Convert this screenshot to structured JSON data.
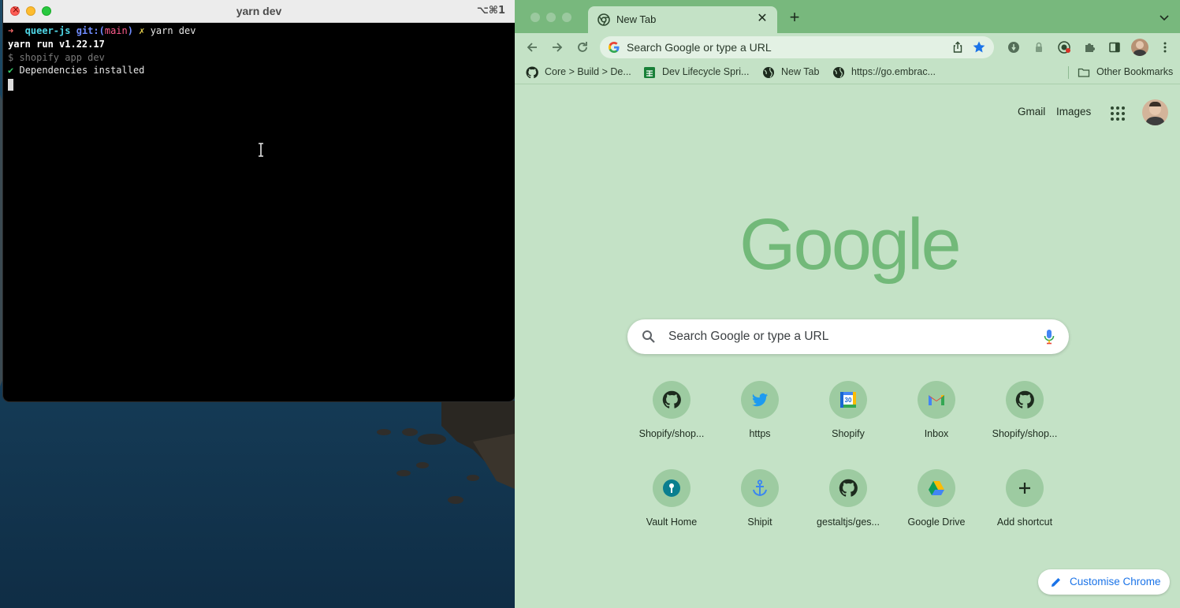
{
  "terminal": {
    "title": "yarn dev",
    "shortcut": "⌥⌘1",
    "prompt_arrow": "➜",
    "prompt_dir": "queer-js",
    "prompt_git": "git:(",
    "prompt_branch": "main",
    "prompt_git_close": ")",
    "prompt_dirty": "✗",
    "prompt_command": "yarn dev",
    "line_yarn_run": "yarn run v1.22.17",
    "line_shopify": "$ shopify app dev",
    "line_check": "✔",
    "line_deps": "Dependencies installed"
  },
  "browser": {
    "tab_title": "New Tab",
    "omnibox_placeholder": "Search Google or type a URL",
    "bookmarks": [
      {
        "label": "Core > Build > De...",
        "icon": "github-icon"
      },
      {
        "label": "Dev Lifecycle Spri...",
        "icon": "sheets-icon"
      },
      {
        "label": "New Tab",
        "icon": "globe-icon"
      },
      {
        "label": "https://go.embrac...",
        "icon": "globe-icon"
      }
    ],
    "other_bookmarks": "Other Bookmarks"
  },
  "ntp": {
    "gmail": "Gmail",
    "images": "Images",
    "logo_text": "Google",
    "search_placeholder": "Search Google or type a URL",
    "shortcuts": [
      {
        "label": "Shopify/shop...",
        "icon": "github-icon"
      },
      {
        "label": "https",
        "icon": "twitter-icon"
      },
      {
        "label": "Shopify",
        "icon": "calendar-icon"
      },
      {
        "label": "Inbox",
        "icon": "gmail-icon"
      },
      {
        "label": "Shopify/shop...",
        "icon": "github-icon"
      },
      {
        "label": "Vault Home",
        "icon": "vault-icon"
      },
      {
        "label": "Shipit",
        "icon": "anchor-icon"
      },
      {
        "label": "gestaltjs/ges...",
        "icon": "github-icon"
      },
      {
        "label": "Google Drive",
        "icon": "drive-icon"
      },
      {
        "label": "Add shortcut",
        "icon": "plus-icon"
      }
    ],
    "customise": "Customise Chrome"
  },
  "colors": {
    "browser_bg": "#c4e2c6",
    "tabstrip": "#78b87d",
    "logo": "#72b979",
    "link_blue": "#1a73e8"
  }
}
